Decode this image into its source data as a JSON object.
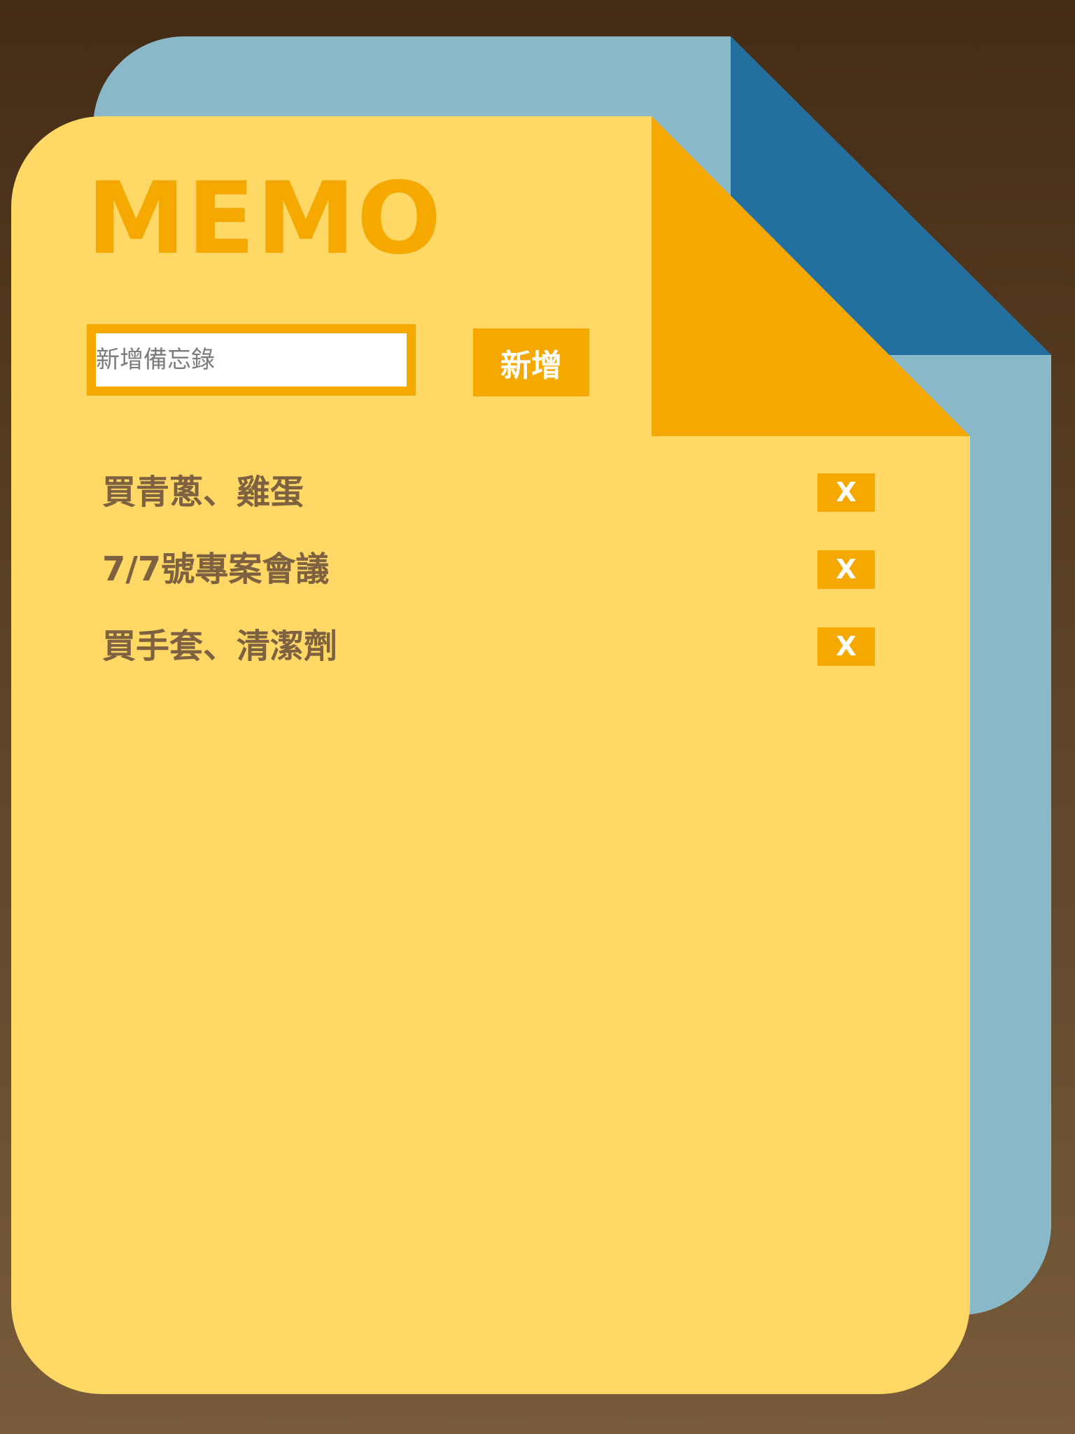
{
  "app": {
    "title": "MEMO"
  },
  "memo_input": {
    "placeholder": "新增備忘錄",
    "value": ""
  },
  "add_button": {
    "label": "新增"
  },
  "memos": [
    {
      "text": "買青蔥、雞蛋",
      "delete_label": "X"
    },
    {
      "text": "7/7號專案會議",
      "delete_label": "X"
    },
    {
      "text": "買手套、清潔劑",
      "delete_label": "X"
    }
  ],
  "colors": {
    "background_top": "#452c15",
    "background_bottom": "#775b3a",
    "back_page": "#89b9c9",
    "back_fold": "#236f9f",
    "front_page": "#ffd866",
    "accent": "#f5a800",
    "memo_text": "#7d6140"
  }
}
